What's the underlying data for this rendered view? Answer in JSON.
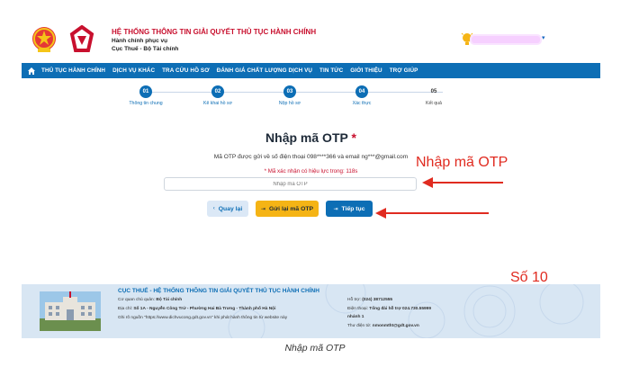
{
  "header": {
    "site_title": "HỆ THỐNG THÔNG TIN GIẢI QUYẾT THỦ TỤC HÀNH CHÍNH",
    "subtitle_1": "Hành chính phục vụ",
    "subtitle_2": "Cục Thuế - Bộ Tài chính",
    "user_name": "",
    "user_caret": "▾"
  },
  "nav": {
    "items": [
      "THỦ TỤC HÀNH CHÍNH",
      "DỊCH VỤ KHÁC",
      "TRA CỨU HỒ SƠ",
      "ĐÁNH GIÁ CHẤT LƯỢNG DỊCH VỤ",
      "TIN TỨC",
      "GIỚI THIỆU",
      "TRỢ GIÚP"
    ]
  },
  "stepper": {
    "steps": [
      {
        "num": "01",
        "label": "Thông tin chung",
        "done": true
      },
      {
        "num": "02",
        "label": "Kê khai hồ sơ",
        "done": true
      },
      {
        "num": "03",
        "label": "Nộp hồ sơ",
        "done": true
      },
      {
        "num": "04",
        "label": "Xác thực",
        "done": true
      },
      {
        "num": "05",
        "label": "Kết quả",
        "done": false
      }
    ]
  },
  "otp": {
    "title": "Nhập mã OTP",
    "required_mark": "*",
    "info": "Mã OTP được gửi về số điện thoại 098****366 và email ng***@gmail.com",
    "timer": "* Mã xác nhận có hiệu lực trong: 118s",
    "input_placeholder": "Nhập mã OTP",
    "input_value": "",
    "back_label": "Quay lại",
    "back_icon": "‹",
    "resend_label": "Gửi lại mã OTP",
    "resend_icon": "⇥",
    "next_label": "Tiếp tục",
    "next_icon": "⇥"
  },
  "annotations": {
    "otp_label": "Nhập mã OTP",
    "step_no": "Số 10"
  },
  "footer": {
    "title": "CỤC THUẾ - HỆ THỐNG THÔNG TIN GIẢI QUYẾT THỦ TỤC HÀNH CHÍNH",
    "agency_label": "Cơ quan chủ quản:",
    "agency_value": "Bộ Tài chính",
    "address_label": "Địa chỉ:",
    "address_value": "Số 1A - Nguyễn Công Trứ - Phường Hai Bà Trưng - Thành phố Hà Nội",
    "source_note": "Ghi rõ nguồn \"https://www.dichvucong.gdt.gov.vn\" khi phát hành thông tin từ website này",
    "phone_label": "Hỗ trợ:",
    "phone_value": "(024) 38712555",
    "hotline_label": "Điện thoại:",
    "hotline_value": "Tổng đài hỗ trợ 024.730.55999",
    "hotline_ext": "nhánh 1",
    "email_label": "Thư điện tử:",
    "email_value": "nmonmtht@gdt.gov.vn"
  },
  "caption": "Nhập mã OTP",
  "colors": {
    "brand_blue": "#0d6eb5",
    "accent_red": "#c8102e",
    "annotation_red": "#e02b20",
    "button_yellow": "#f5b415"
  }
}
